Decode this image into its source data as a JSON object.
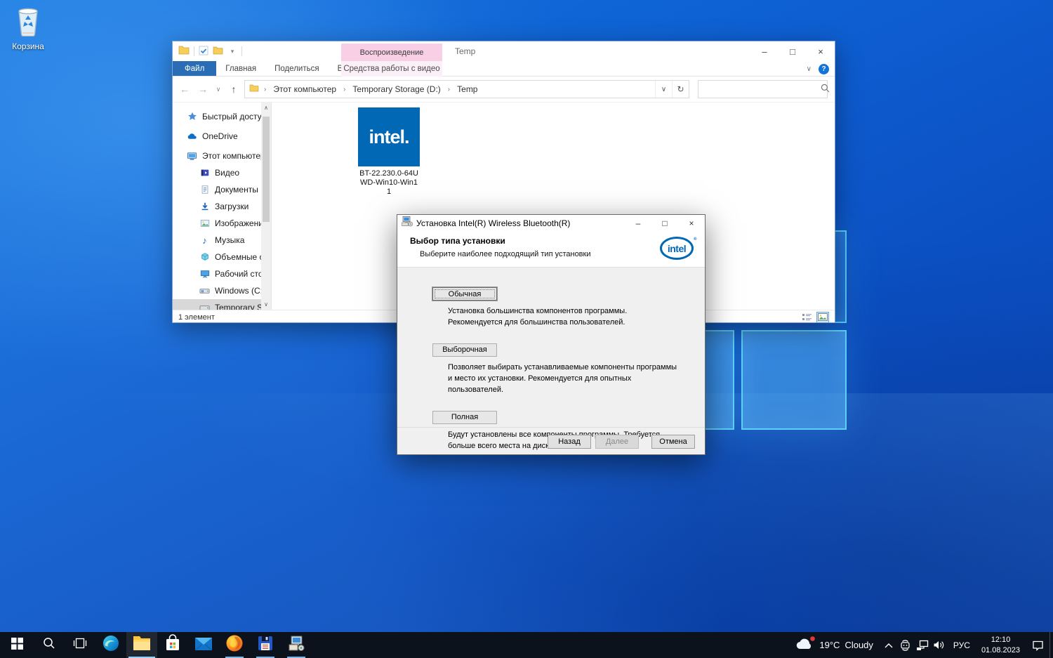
{
  "desktop": {
    "recycle_bin_label": "Корзина"
  },
  "icons": {
    "minimize": "–",
    "maximize": "□",
    "close": "×",
    "back": "←",
    "forward": "→",
    "up": "↑",
    "refresh": "↻",
    "chevron_down": "∨",
    "chevron_up": "∧",
    "help": "?",
    "check": "✓",
    "dropdown": "▾",
    "breadcrumb_sep": "›",
    "music_note": "♪"
  },
  "explorer": {
    "title": "Temp",
    "contextual_header": "Воспроизведение",
    "tabs": {
      "file": "Файл",
      "home": "Главная",
      "share": "Поделиться",
      "view": "Вид",
      "video_tools": "Средства работы с видео"
    },
    "breadcrumb": {
      "root": "Этот компьютер",
      "drive": "Temporary Storage (D:)",
      "folder": "Temp"
    },
    "sidebar": {
      "items": [
        {
          "label": "Быстрый доступ"
        },
        {
          "label": "OneDrive"
        },
        {
          "label": "Этот компьютер"
        },
        {
          "label": "Видео"
        },
        {
          "label": "Документы"
        },
        {
          "label": "Загрузки"
        },
        {
          "label": "Изображения"
        },
        {
          "label": "Музыка"
        },
        {
          "label": "Объемные объ"
        },
        {
          "label": "Рабочий стол"
        },
        {
          "label": "Windows (C:)"
        },
        {
          "label": "Temporary Stora"
        }
      ]
    },
    "file_item": {
      "icon_text": "intel.",
      "name": "BT-22.230.0-64U\nWD-Win10-Win1\n1"
    },
    "status": "1 элемент"
  },
  "installer": {
    "title": "Установка Intel(R) Wireless Bluetooth(R)",
    "heading": "Выбор типа установки",
    "subheading": "Выберите наиболее подходящий тип установки",
    "logo_text": "intel",
    "options": [
      {
        "button": "Обычная",
        "desc": "Установка большинства компонентов программы. Рекомендуется для большинства пользователей."
      },
      {
        "button": "Выборочная",
        "desc": "Позволяет выбирать устанавливаемые компоненты программы и место их установки. Рекомендуется для опытных пользователей."
      },
      {
        "button": "Полная",
        "desc": "Будут установлены все компоненты программы. Требуется больше всего места на диске."
      }
    ],
    "footer": {
      "back": "Назад",
      "next": "Далее",
      "cancel": "Отмена"
    }
  },
  "taskbar": {
    "weather": {
      "temp": "19°C",
      "condition": "Cloudy"
    },
    "language": "РУС",
    "clock": {
      "time": "12:10",
      "date": "01.08.2023"
    }
  },
  "colors": {
    "intel_blue": "#0068b5",
    "accent": "#0078d7",
    "contextual_pink": "#f8cfe4"
  }
}
